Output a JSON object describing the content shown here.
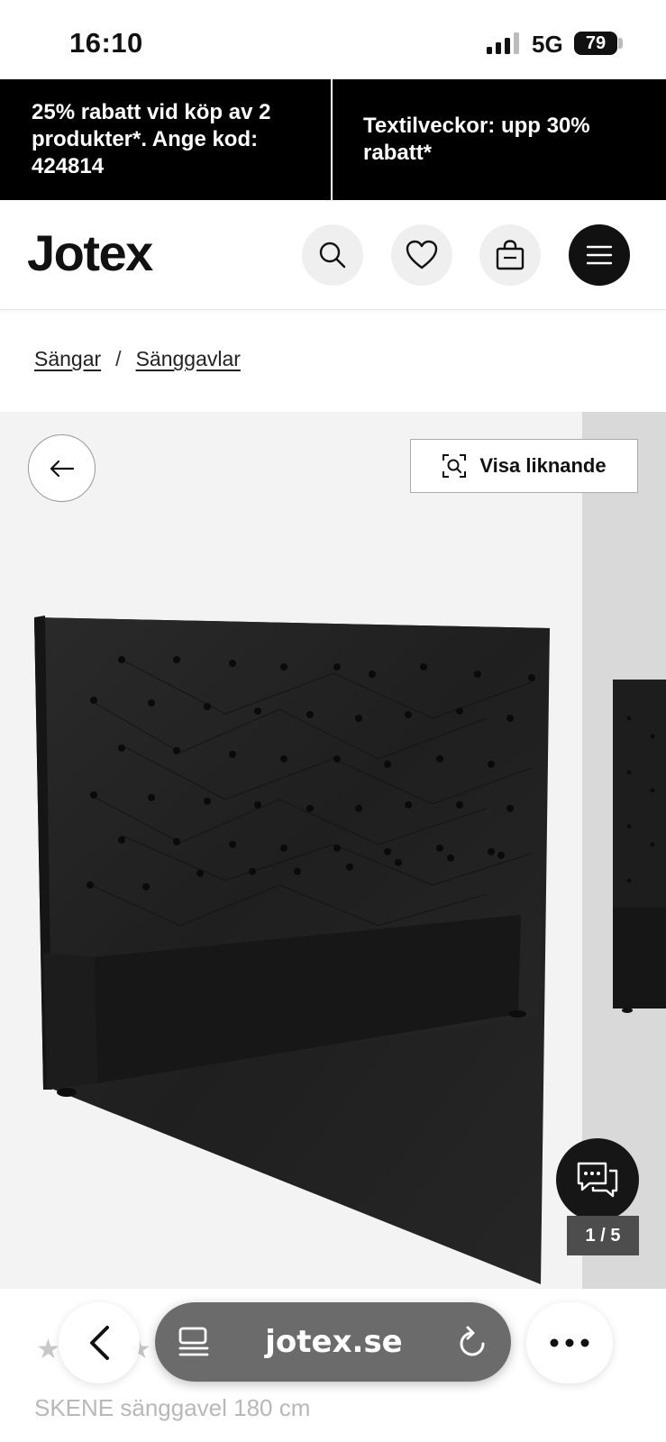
{
  "status_bar": {
    "time": "16:10",
    "network": "5G",
    "battery": "79"
  },
  "promo": {
    "left_text": "25% rabatt vid köp av 2 produkter*. Ange kod: 424814",
    "right_text": "Textilveckor: upp 30% rabatt*"
  },
  "header": {
    "logo": "Jotex",
    "icons": [
      "search-icon",
      "heart-icon",
      "bag-icon",
      "menu-icon"
    ]
  },
  "breadcrumb": {
    "items": [
      "Sängar",
      "Sänggavlar"
    ],
    "separator": "/"
  },
  "gallery": {
    "similar_label": "Visa liknande",
    "counter": "1 / 5"
  },
  "product": {
    "name": "SKENE sänggavel 180 cm"
  },
  "browser": {
    "url": "jotex.se"
  },
  "colors": {
    "brand_black": "#000000",
    "gallery_bg": "#f3f3f3",
    "counter_bg": "#4d4d4d"
  }
}
